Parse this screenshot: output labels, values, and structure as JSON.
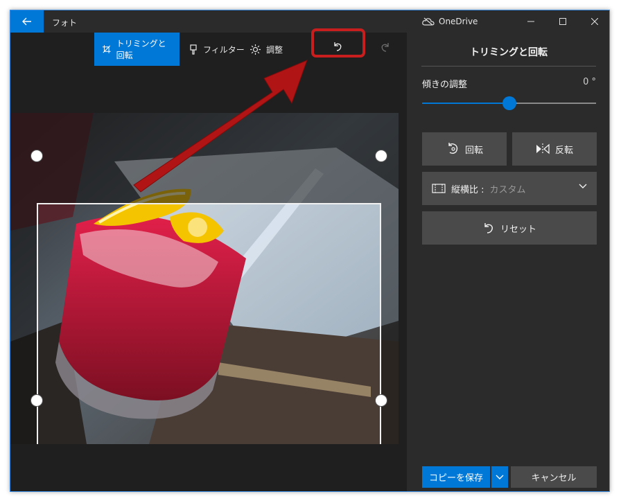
{
  "app": {
    "title": "フォト",
    "onedrive_label": "OneDrive"
  },
  "toolbar": {
    "crop_rotate_label": "トリミングと回転",
    "filter_label": "フィルター",
    "adjust_label": "調整"
  },
  "panel": {
    "title": "トリミングと回転",
    "tilt": {
      "label": "傾きの調整",
      "value_text": "0 °",
      "level": 0.5
    },
    "rotate_label": "回転",
    "flip_label": "反転",
    "aspect_label": "縦横比 :",
    "aspect_value": "カスタム",
    "reset_label": "リセット"
  },
  "footer": {
    "save_copy_label": "コピーを保存",
    "cancel_label": "キャンセル"
  },
  "colors": {
    "accent": "#0078d7",
    "highlight": "#c81e1e",
    "drink": "#c0143c",
    "lemon": "#f5c400"
  },
  "icons": [
    "back-arrow-icon",
    "onedrive-icon",
    "minimize-icon",
    "maximize-icon",
    "close-icon",
    "crop-icon",
    "filter-brush-icon",
    "brightness-icon",
    "undo-icon",
    "redo-icon",
    "rotate-icon",
    "flip-icon",
    "aspect-ratio-icon",
    "chevron-down-icon",
    "reset-icon"
  ]
}
